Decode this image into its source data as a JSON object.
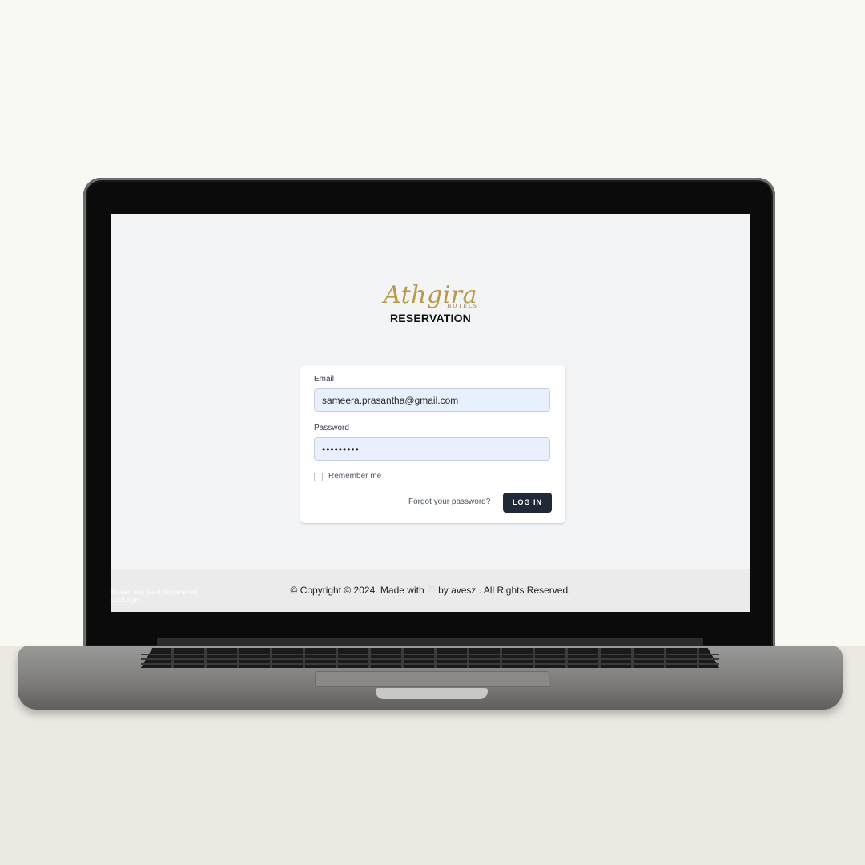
{
  "logo": {
    "script": "Athgira",
    "hotels": "HOTELS",
    "subtitle": "RESERVATION"
  },
  "form": {
    "email_label": "Email",
    "email_value": "sameera.prasantha@gmail.com",
    "password_label": "Password",
    "password_value": "•••••••••",
    "remember_label": "Remember me",
    "forgot_link": "Forgot your password?",
    "login_button": "LOG IN"
  },
  "footer": {
    "copyright_prefix": "© Copyright © 2024. Made with",
    "copyright_suffix": "by avesz . All Rights Reserved.",
    "faint_text_line1": "Explain and Send Screenshots",
    "faint_text_line2": "Lab/Login"
  },
  "colors": {
    "logo_gold": "#b89b4a",
    "button_dark": "#1f2937",
    "input_fill": "#e8f0fe",
    "screen_bg": "#f3f4f6"
  },
  "icons": {
    "heart": "heart-icon"
  }
}
